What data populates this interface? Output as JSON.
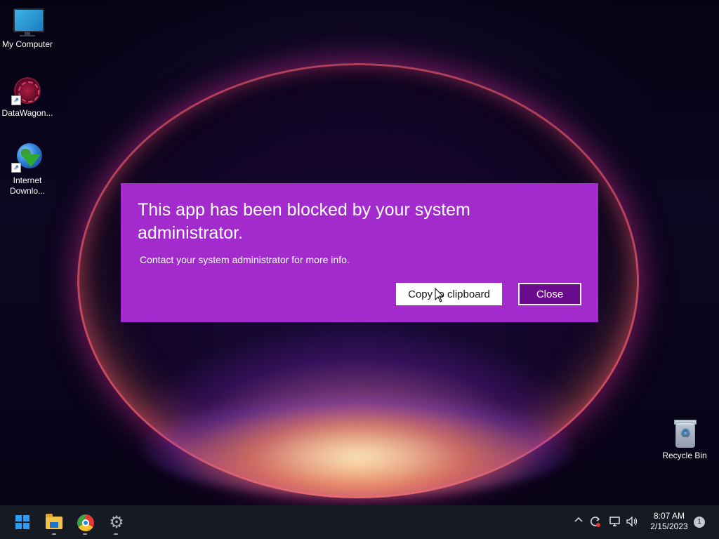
{
  "desktop": {
    "icons": [
      {
        "label": "My Computer",
        "icon": "monitor-icon"
      },
      {
        "label": "DataWagon...",
        "icon": "datawagon-icon"
      },
      {
        "label": "Internet\nDownlo...",
        "label_line1": "Internet",
        "label_line2": "Downlo...",
        "icon": "internet-download-manager-icon"
      },
      {
        "label": "Recycle Bin",
        "icon": "recycle-bin-icon"
      }
    ]
  },
  "dialog": {
    "title": "This app has been blocked by your system administrator.",
    "message": "Contact your system administrator for more info.",
    "copy_button": "Copy to clipboard",
    "close_button": "Close",
    "background": "#a32bce",
    "close_button_bg": "#6a0a8c"
  },
  "taskbar": {
    "apps": [
      "start-icon",
      "file-explorer-icon",
      "chrome-icon",
      "settings-icon"
    ],
    "tray": {
      "chevron": "^",
      "time": "8:07 AM",
      "date": "2/15/2023",
      "notification_count": "1"
    }
  }
}
